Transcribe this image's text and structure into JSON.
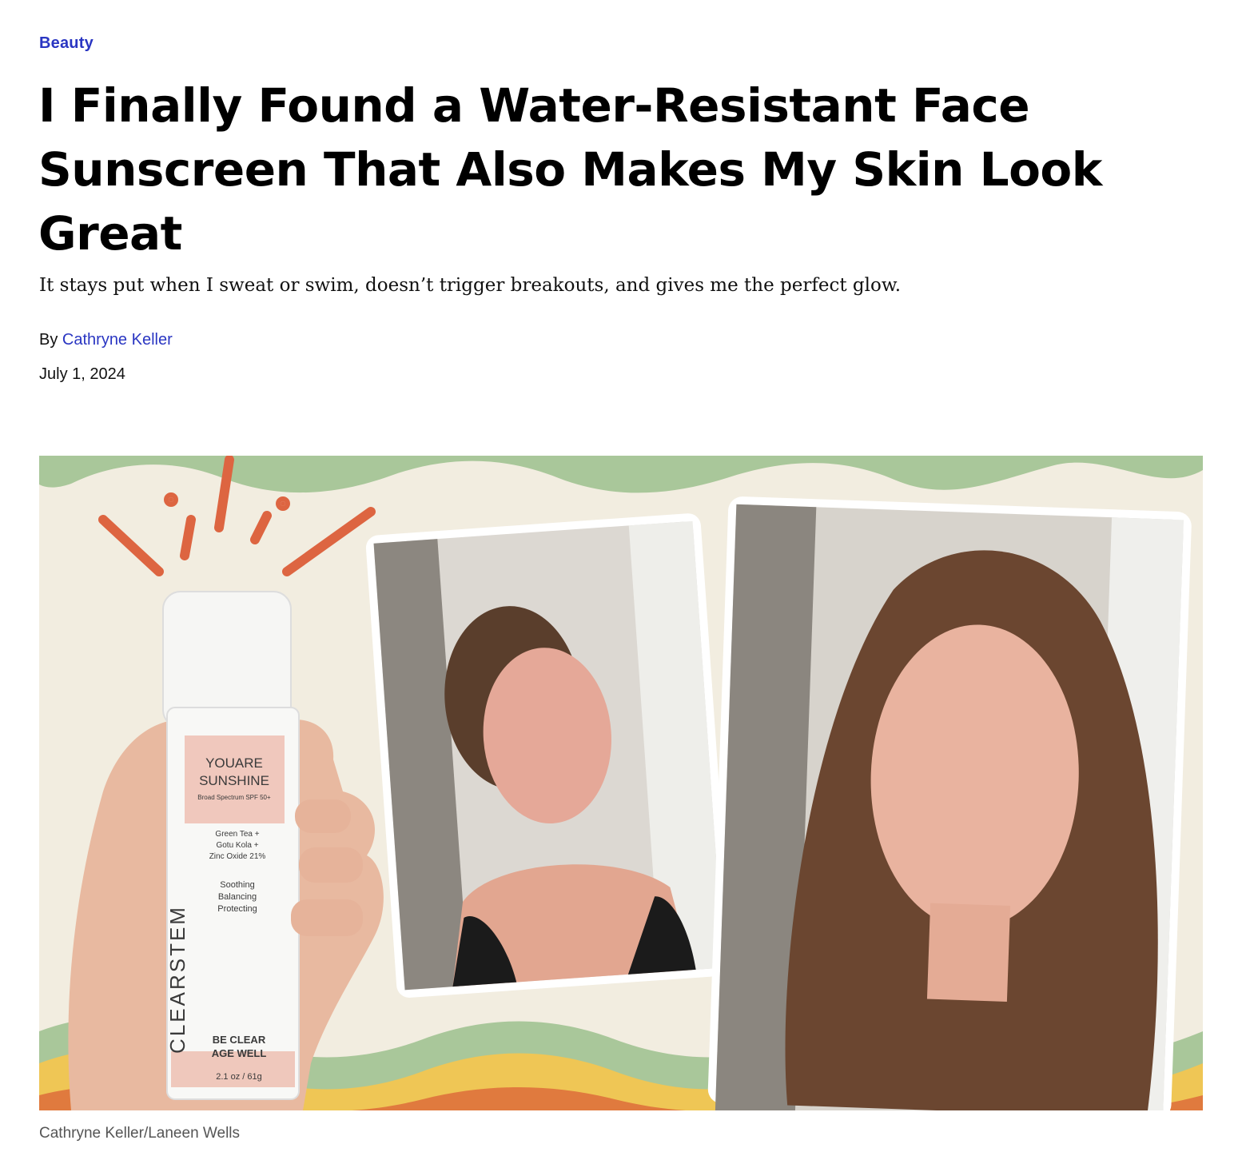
{
  "article": {
    "category": "Beauty",
    "headline": "I Finally Found a Water-Resistant Face Sunscreen That Also Makes My Skin Look Great",
    "dek": "It stays put when I sweat or swim, doesn’t trigger breakouts, and gives me the perfect glow.",
    "byline_prefix": "By",
    "author": "Cathryne Keller",
    "date": "July 1, 2024"
  },
  "hero_image": {
    "caption": "Cathryne Keller/Laneen Wells",
    "product": {
      "line1": "YOUARE",
      "line2": "SUNSHINE",
      "spf": "Broad Spectrum SPF 50+",
      "ing1": "Green Tea +",
      "ing2": "Gotu Kola +",
      "ing3": "Zinc Oxide 21%",
      "ben1": "Soothing",
      "ben2": "Balancing",
      "ben3": "Protecting",
      "brand": "CLEARSTEM",
      "tag1": "BE CLEAR",
      "tag2": "AGE WELL",
      "size": "2.1 oz / 61g"
    }
  },
  "colors": {
    "link": "#2a36c2",
    "wave_green": "#a9c79a",
    "wave_yellow": "#efc655",
    "wave_orange": "#e07a3e",
    "accent_rays": "#dd6541"
  }
}
